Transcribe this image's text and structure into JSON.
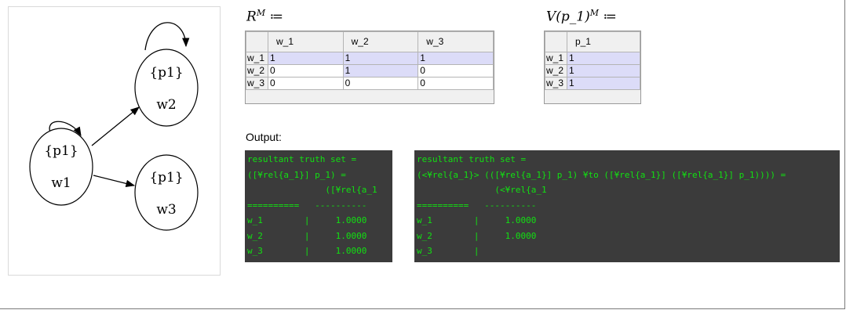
{
  "graph": {
    "nodes": [
      {
        "id": "w1",
        "prop": "{p1}",
        "label": "w1"
      },
      {
        "id": "w2",
        "prop": "{p1}",
        "label": "w2"
      },
      {
        "id": "w3",
        "prop": "{p1}",
        "label": "w3"
      }
    ],
    "edges": [
      {
        "from": "w1",
        "to": "w1"
      },
      {
        "from": "w1",
        "to": "w2"
      },
      {
        "from": "w1",
        "to": "w3"
      },
      {
        "from": "w2",
        "to": "w2"
      }
    ]
  },
  "relation_table": {
    "label_base": "R",
    "label_sup": "M",
    "label_op": " ≔",
    "columns": [
      "w_1",
      "w_2",
      "w_3"
    ],
    "rows": [
      {
        "header": "w_1",
        "cells": [
          "1",
          "1",
          "1"
        ],
        "selected": [
          true,
          true,
          true
        ]
      },
      {
        "header": "w_2",
        "cells": [
          "0",
          "1",
          "0"
        ],
        "selected": [
          false,
          true,
          false
        ]
      },
      {
        "header": "w_3",
        "cells": [
          "0",
          "0",
          "0"
        ],
        "selected": [
          false,
          false,
          false
        ]
      }
    ]
  },
  "valuation_table": {
    "label_base": "V(p_1)",
    "label_sup": "M",
    "label_op": " ≔",
    "columns": [
      "p_1"
    ],
    "rows": [
      {
        "header": "w_1",
        "cells": [
          "1"
        ],
        "selected": [
          true
        ]
      },
      {
        "header": "w_2",
        "cells": [
          "1"
        ],
        "selected": [
          true
        ]
      },
      {
        "header": "w_3",
        "cells": [
          "1"
        ],
        "selected": [
          true
        ]
      }
    ]
  },
  "output_label": "Output:",
  "console_left": {
    "lines": [
      "resultant truth set =",
      "([¥rel{a_1}] p_1) =",
      "               ([¥rel{a_1",
      "==========   ----------",
      "w_1        |     1.0000",
      "w_2        |     1.0000",
      "w_3        |     1.0000"
    ]
  },
  "console_right": {
    "lines": [
      "resultant truth set =",
      "(<¥rel{a_1}> (([¥rel{a_1}] p_1) ¥to ([¥rel{a_1}] ([¥rel{a_1}] p_1)))) =",
      "               (<¥rel{a_1",
      "==========   ----------",
      "w_1        |     1.0000",
      "w_2        |     1.0000",
      "w_3        |"
    ]
  }
}
